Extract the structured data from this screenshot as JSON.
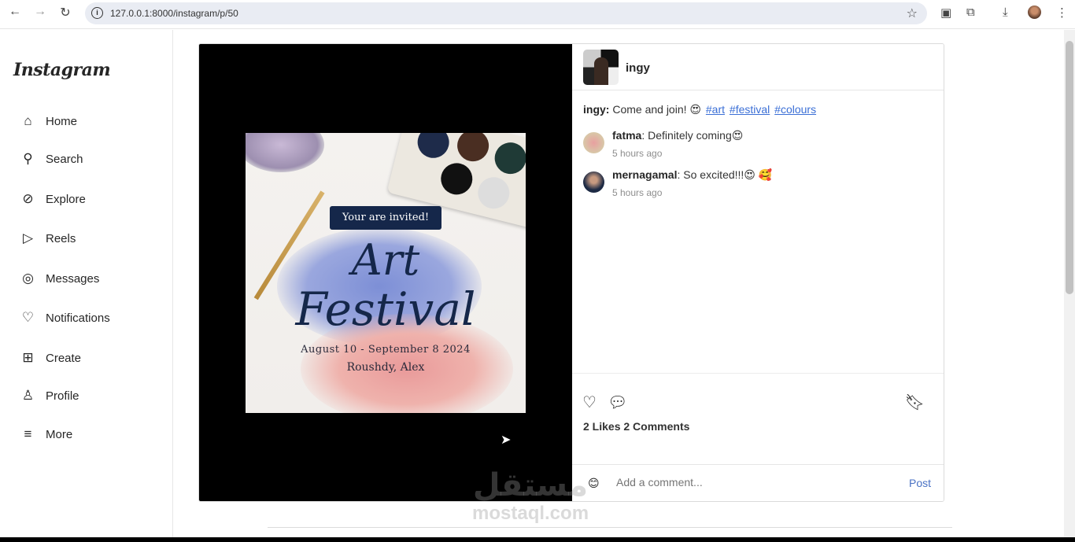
{
  "browser": {
    "url": "127.0.0.1:8000/instagram/p/50"
  },
  "sidebar": {
    "logo": "Instagram",
    "items": [
      {
        "label": "Home",
        "icon": "home-icon"
      },
      {
        "label": "Search",
        "icon": "search-icon"
      },
      {
        "label": "Explore",
        "icon": "compass-icon"
      },
      {
        "label": "Reels",
        "icon": "reels-icon"
      },
      {
        "label": "Messages",
        "icon": "messenger-icon"
      },
      {
        "label": "Notifications",
        "icon": "heart-icon"
      },
      {
        "label": "Create",
        "icon": "plus-square-icon"
      },
      {
        "label": "Profile",
        "icon": "user-icon"
      },
      {
        "label": "More",
        "icon": "menu-icon"
      }
    ]
  },
  "post": {
    "username": "ingy",
    "poster": {
      "banner": "Your are invited!",
      "title1": "Art",
      "title2": "Festival",
      "dates": "August 10 - September 8 2024",
      "place": "Roushdy, Alex"
    },
    "caption": {
      "user": "ingy:",
      "text": "Come and join! 😍",
      "tags": [
        "#art",
        "#festival",
        "#colours"
      ]
    },
    "comments": [
      {
        "user": "fatma",
        "text": ": Definitely coming😍",
        "time": "5 hours ago"
      },
      {
        "user": "mernagamal",
        "text": ": So excited!!!😍 🥰",
        "time": "5 hours ago"
      }
    ],
    "stats": "2 Likes 2 Comments",
    "comment_placeholder": "Add a comment...",
    "post_label": "Post"
  },
  "watermark": {
    "arabic": "مستقل",
    "latin": "mostaql.com"
  }
}
